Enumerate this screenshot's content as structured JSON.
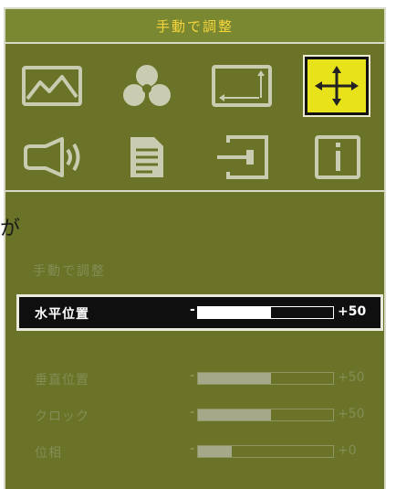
{
  "menu": {
    "title": "手動で調整",
    "icons": [
      {
        "name": "picture-icon",
        "selected": false
      },
      {
        "name": "color-icon",
        "selected": false
      },
      {
        "name": "image-size-icon",
        "selected": false
      },
      {
        "name": "position-icon",
        "selected": true
      },
      {
        "name": "sound-icon",
        "selected": false
      },
      {
        "name": "document-icon",
        "selected": false
      },
      {
        "name": "input-icon",
        "selected": false
      },
      {
        "name": "info-icon",
        "selected": false
      }
    ],
    "stray_text": "が",
    "section_title": "手動で調整",
    "rows": [
      {
        "label": "水平位置",
        "dash": "-",
        "value": "+50",
        "level": 0.54,
        "active": true
      },
      {
        "label": "垂直位置",
        "dash": "-",
        "value": "+50",
        "level": 0.54,
        "active": false
      },
      {
        "label": "クロック",
        "dash": "-",
        "value": "+50",
        "level": 0.54,
        "active": false
      },
      {
        "label": "位相",
        "dash": "-",
        "value": "+0",
        "level": 0.25,
        "active": false
      }
    ]
  },
  "colors": {
    "panel": "#6a7328",
    "title_text": "#f5d53b",
    "selected_icon_bg": "#e8e21a",
    "active_row_bg": "#0f0f0f",
    "dim_text": "#858c55"
  }
}
